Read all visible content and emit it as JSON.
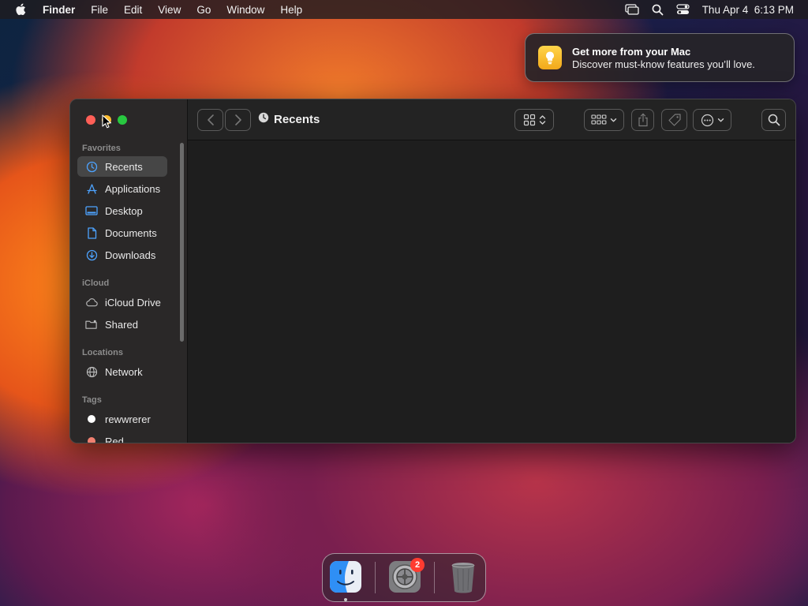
{
  "menubar": {
    "app_name": "Finder",
    "items": [
      "File",
      "Edit",
      "View",
      "Go",
      "Window",
      "Help"
    ],
    "clock": "Thu Apr 4  6:13 PM",
    "icons": [
      "apple-icon",
      "screen-mirroring-icon",
      "spotlight-search-icon",
      "control-center-icon"
    ]
  },
  "notification": {
    "title": "Get more from your Mac",
    "body": "Discover must-know features you’ll love.",
    "icon": "tips-lightbulb-icon"
  },
  "window": {
    "title": "Recents",
    "toolbar_icons": [
      "back-icon",
      "forward-icon",
      "icon-view-icon",
      "group-icon",
      "share-icon",
      "tag-icon",
      "more-actions-icon",
      "search-icon"
    ]
  },
  "sidebar": {
    "favorites_label": "Favorites",
    "favorites": [
      {
        "label": "Recents",
        "icon": "clock-icon"
      },
      {
        "label": "Applications",
        "icon": "applications-icon"
      },
      {
        "label": "Desktop",
        "icon": "desktop-icon"
      },
      {
        "label": "Documents",
        "icon": "document-icon"
      },
      {
        "label": "Downloads",
        "icon": "downloads-icon"
      }
    ],
    "icloud_label": "iCloud",
    "icloud": [
      {
        "label": "iCloud Drive",
        "icon": "cloud-icon"
      },
      {
        "label": "Shared",
        "icon": "shared-folder-icon"
      }
    ],
    "locations_label": "Locations",
    "locations": [
      {
        "label": "Network",
        "icon": "globe-icon"
      }
    ],
    "tags_label": "Tags",
    "tags": [
      {
        "label": "rewwrerer",
        "color": "#ffffff"
      },
      {
        "label": "Red",
        "color": "#f08070"
      }
    ]
  },
  "dock": {
    "apps": [
      {
        "name": "Finder",
        "icon": "finder-icon"
      },
      {
        "name": "System Settings",
        "icon": "system-settings-icon",
        "badge": "2"
      },
      {
        "name": "Trash",
        "icon": "trash-icon"
      }
    ]
  },
  "colors": {
    "close": "#ff5f57",
    "minimize": "#febc2e",
    "zoom": "#28c840",
    "accent": "#4da3ff",
    "badge": "#ff3b30"
  }
}
